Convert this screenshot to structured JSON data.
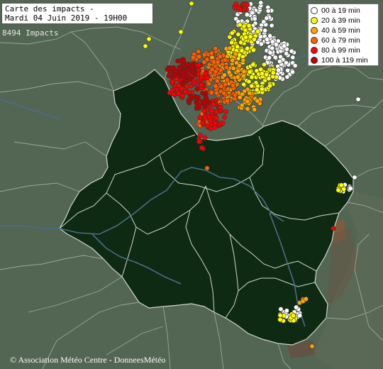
{
  "title": {
    "line1": "Carte des impacts -",
    "line2": "Mardi 04 Juin 2019 - 19H00"
  },
  "impact_count": "8494 Impacts",
  "legend": [
    {
      "label": "00 à 19 min",
      "color": "#ffffff"
    },
    {
      "label": "20 à 39 min",
      "color": "#ffff00"
    },
    {
      "label": "40 à 59 min",
      "color": "#ffa500"
    },
    {
      "label": "60 à 79 min",
      "color": "#ff6000"
    },
    {
      "label": "80 à 99 min",
      "color": "#ff0000"
    },
    {
      "label": "100 à 119 min",
      "color": "#c00000"
    }
  ],
  "credit": "© Association Météo Centre - DonneesMétéo",
  "colors": {
    "background": "#4a5a4a",
    "region_fill": "#0f2a12",
    "outside_fill": "#536553",
    "department_border": "#cfd6cf",
    "river": "#4a6c8c"
  }
}
